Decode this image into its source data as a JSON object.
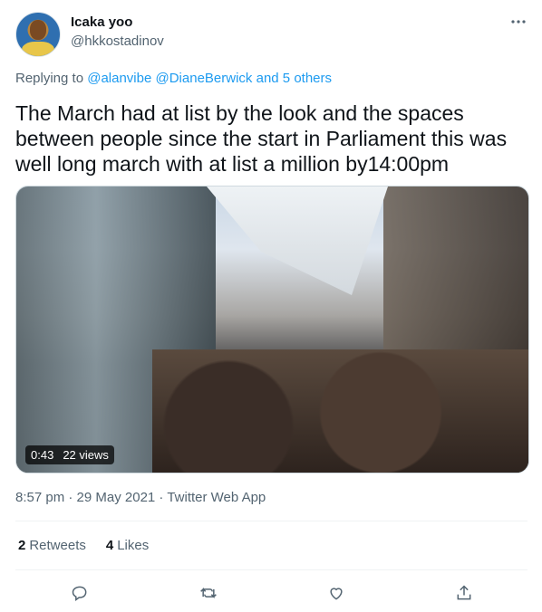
{
  "user": {
    "name": "Icaka yoo",
    "handle": "@hkkostadinov"
  },
  "reply": {
    "prefix": "Replying to",
    "mentions": [
      "@alanvibe",
      "@DianeBerwick"
    ],
    "others": "and 5 others"
  },
  "tweet": {
    "lines": [
      "The March had at list by the look and the spaces",
      "between  people since the start in Parliament this was",
      "well long march with at list  a million by14:00pm"
    ]
  },
  "media": {
    "duration": "0:43",
    "views": "22 views"
  },
  "meta": {
    "timestamp": "8:57 pm · 29 May 2021 · Twitter Web App"
  },
  "stats": {
    "retweets_count": "2",
    "retweets_label": "Retweets",
    "likes_count": "4",
    "likes_label": "Likes"
  },
  "colors": {
    "accent": "#1d9bf0",
    "muted": "#536471",
    "text": "#0f1419"
  },
  "icons": {
    "reply": "reply-icon",
    "retweet": "retweet-icon",
    "like": "heart-icon",
    "share": "share-icon",
    "more": "more-icon"
  }
}
